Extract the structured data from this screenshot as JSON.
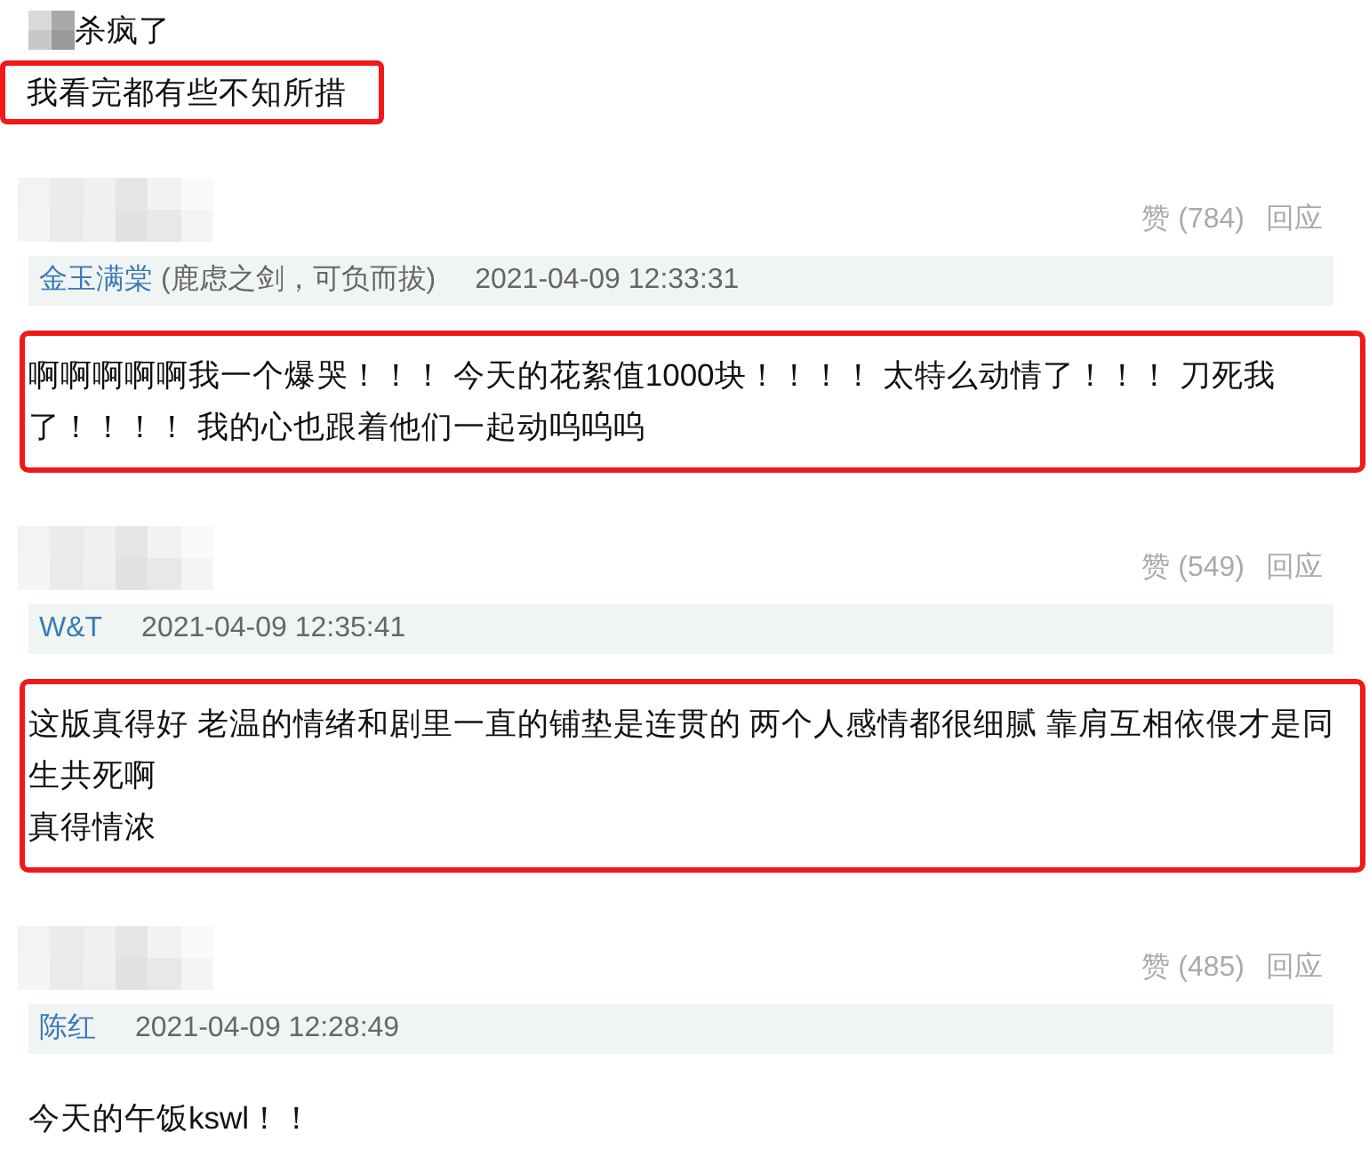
{
  "intro": [
    {
      "text": "杀疯了",
      "redacted_prefix": true,
      "highlighted": false
    },
    {
      "text": "我看完都有些不知所措",
      "redacted_prefix": false,
      "highlighted": true
    }
  ],
  "comments": [
    {
      "likes": "赞 (784)",
      "reply": "回应",
      "user": "金玉满棠",
      "user_note": "(鹿虑之剑，可负而拔)",
      "time": "2021-04-09 12:33:31",
      "highlighted": true,
      "paragraphs": [
        "啊啊啊啊啊我一个爆哭！！！ 今天的花絮值1000块！！！！ 太特么动情了！！！ 刀死我了！！！！ 我的心也跟着他们一起动呜呜呜"
      ]
    },
    {
      "likes": "赞 (549)",
      "reply": "回应",
      "user": "W&T",
      "time": "2021-04-09 12:35:41",
      "highlighted": true,
      "paragraphs": [
        "这版真得好 老温的情绪和剧里一直的铺垫是连贯的 两个人感情都很细腻 靠肩互相依偎才是同生共死啊",
        "真得情浓"
      ]
    },
    {
      "likes": "赞 (485)",
      "reply": "回应",
      "user": "陈红",
      "time": "2021-04-09 12:28:49",
      "highlighted": false,
      "paragraphs": [
        "今天的午饭kswl！！"
      ]
    }
  ]
}
